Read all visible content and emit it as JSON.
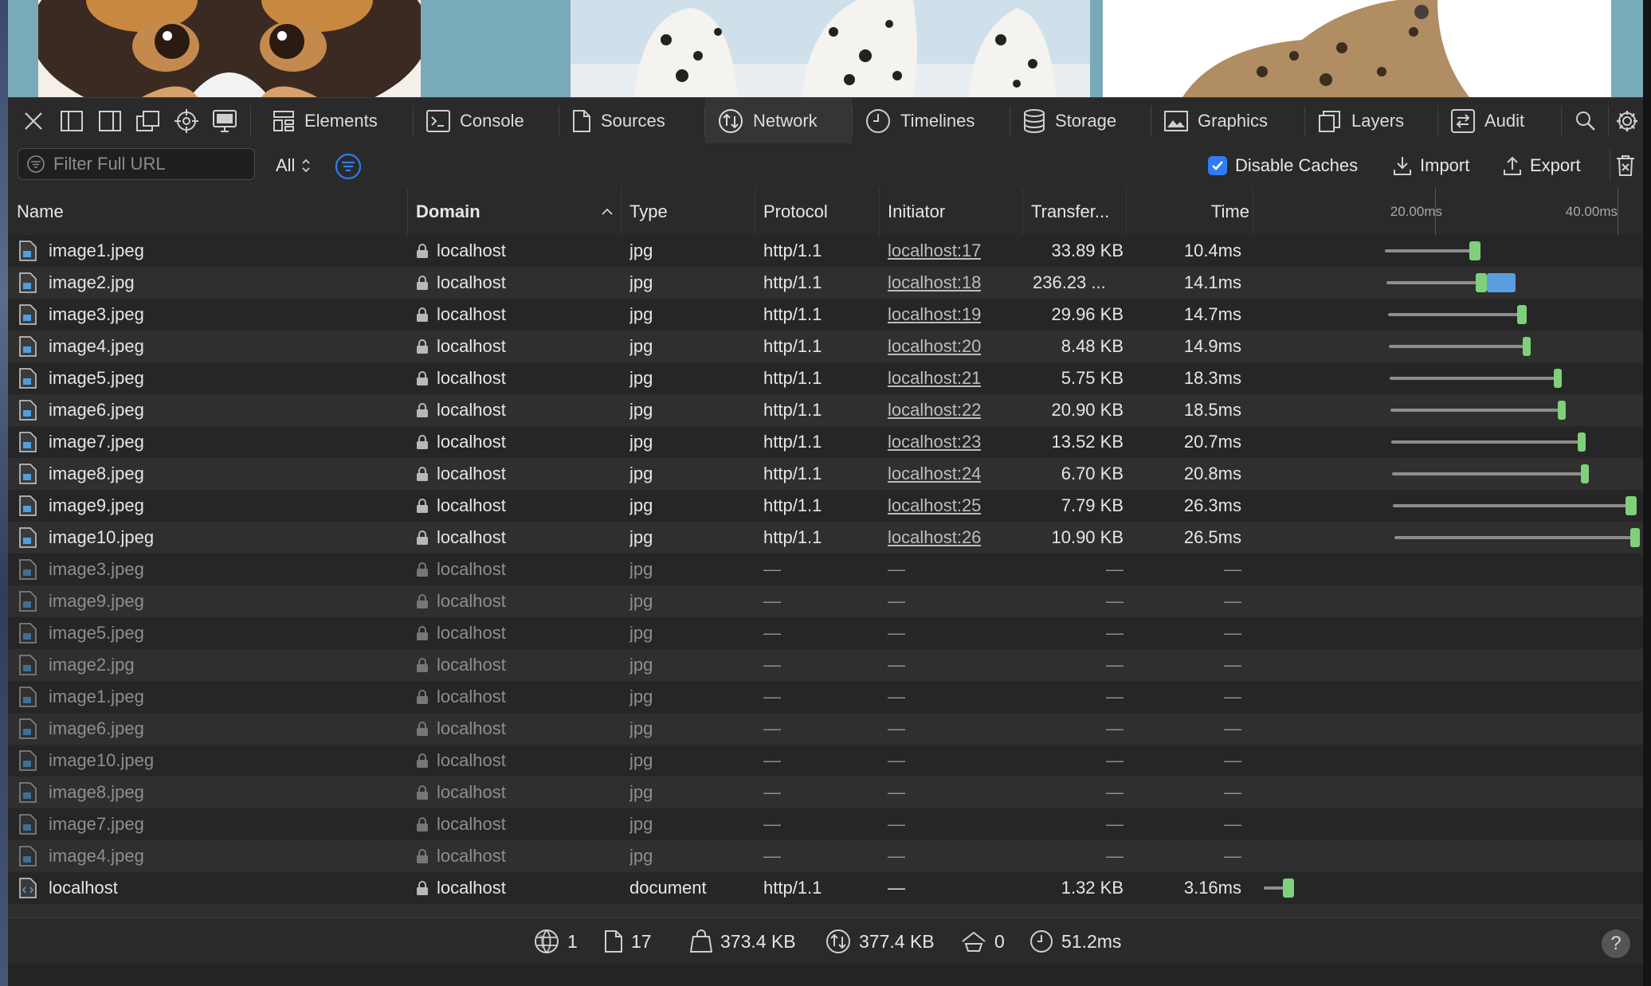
{
  "toolbar": {
    "tabs": [
      {
        "label": "Elements",
        "icon": "elements-icon"
      },
      {
        "label": "Console",
        "icon": "console-icon"
      },
      {
        "label": "Sources",
        "icon": "sources-icon"
      },
      {
        "label": "Network",
        "icon": "network-icon",
        "active": true
      },
      {
        "label": "Timelines",
        "icon": "timelines-icon"
      },
      {
        "label": "Storage",
        "icon": "storage-icon"
      },
      {
        "label": "Graphics",
        "icon": "graphics-icon"
      },
      {
        "label": "Layers",
        "icon": "layers-icon"
      },
      {
        "label": "Audit",
        "icon": "audit-icon"
      }
    ]
  },
  "filterbar": {
    "filter_placeholder": "Filter Full URL",
    "type_filter": "All",
    "disable_caches_label": "Disable Caches",
    "disable_caches_checked": true,
    "import_label": "Import",
    "export_label": "Export"
  },
  "table": {
    "columns": {
      "name": "Name",
      "domain": "Domain",
      "type": "Type",
      "protocol": "Protocol",
      "initiator": "Initiator",
      "transfer": "Transfer...",
      "time": "Time"
    },
    "sort_column": "Domain",
    "waterfall_ticks": [
      "20.00ms",
      "40.00ms"
    ],
    "rows": [
      {
        "name": "image1.jpeg",
        "domain": "localhost",
        "type": "jpg",
        "protocol": "http/1.1",
        "initiator": "localhost:17",
        "transfer": "33.89 KB",
        "time": "10.4ms"
      },
      {
        "name": "image2.jpg",
        "domain": "localhost",
        "type": "jpg",
        "protocol": "http/1.1",
        "initiator": "localhost:18",
        "transfer": "236.23 ...",
        "time": "14.1ms"
      },
      {
        "name": "image3.jpeg",
        "domain": "localhost",
        "type": "jpg",
        "protocol": "http/1.1",
        "initiator": "localhost:19",
        "transfer": "29.96 KB",
        "time": "14.7ms"
      },
      {
        "name": "image4.jpeg",
        "domain": "localhost",
        "type": "jpg",
        "protocol": "http/1.1",
        "initiator": "localhost:20",
        "transfer": "8.48 KB",
        "time": "14.9ms"
      },
      {
        "name": "image5.jpeg",
        "domain": "localhost",
        "type": "jpg",
        "protocol": "http/1.1",
        "initiator": "localhost:21",
        "transfer": "5.75 KB",
        "time": "18.3ms"
      },
      {
        "name": "image6.jpeg",
        "domain": "localhost",
        "type": "jpg",
        "protocol": "http/1.1",
        "initiator": "localhost:22",
        "transfer": "20.90 KB",
        "time": "18.5ms"
      },
      {
        "name": "image7.jpeg",
        "domain": "localhost",
        "type": "jpg",
        "protocol": "http/1.1",
        "initiator": "localhost:23",
        "transfer": "13.52 KB",
        "time": "20.7ms"
      },
      {
        "name": "image8.jpeg",
        "domain": "localhost",
        "type": "jpg",
        "protocol": "http/1.1",
        "initiator": "localhost:24",
        "transfer": "6.70 KB",
        "time": "20.8ms"
      },
      {
        "name": "image9.jpeg",
        "domain": "localhost",
        "type": "jpg",
        "protocol": "http/1.1",
        "initiator": "localhost:25",
        "transfer": "7.79 KB",
        "time": "26.3ms"
      },
      {
        "name": "image10.jpeg",
        "domain": "localhost",
        "type": "jpg",
        "protocol": "http/1.1",
        "initiator": "localhost:26",
        "transfer": "10.90 KB",
        "time": "26.5ms"
      },
      {
        "name": "image3.jpeg",
        "domain": "localhost",
        "type": "jpg",
        "protocol": "—",
        "initiator": "—",
        "transfer": "—",
        "time": "—",
        "dim": true
      },
      {
        "name": "image9.jpeg",
        "domain": "localhost",
        "type": "jpg",
        "protocol": "—",
        "initiator": "—",
        "transfer": "—",
        "time": "—",
        "dim": true
      },
      {
        "name": "image5.jpeg",
        "domain": "localhost",
        "type": "jpg",
        "protocol": "—",
        "initiator": "—",
        "transfer": "—",
        "time": "—",
        "dim": true
      },
      {
        "name": "image2.jpg",
        "domain": "localhost",
        "type": "jpg",
        "protocol": "—",
        "initiator": "—",
        "transfer": "—",
        "time": "—",
        "dim": true
      },
      {
        "name": "image1.jpeg",
        "domain": "localhost",
        "type": "jpg",
        "protocol": "—",
        "initiator": "—",
        "transfer": "—",
        "time": "—",
        "dim": true
      },
      {
        "name": "image6.jpeg",
        "domain": "localhost",
        "type": "jpg",
        "protocol": "—",
        "initiator": "—",
        "transfer": "—",
        "time": "—",
        "dim": true
      },
      {
        "name": "image10.jpeg",
        "domain": "localhost",
        "type": "jpg",
        "protocol": "—",
        "initiator": "—",
        "transfer": "—",
        "time": "—",
        "dim": true
      },
      {
        "name": "image8.jpeg",
        "domain": "localhost",
        "type": "jpg",
        "protocol": "—",
        "initiator": "—",
        "transfer": "—",
        "time": "—",
        "dim": true
      },
      {
        "name": "image7.jpeg",
        "domain": "localhost",
        "type": "jpg",
        "protocol": "—",
        "initiator": "—",
        "transfer": "—",
        "time": "—",
        "dim": true
      },
      {
        "name": "image4.jpeg",
        "domain": "localhost",
        "type": "jpg",
        "protocol": "—",
        "initiator": "—",
        "transfer": "—",
        "time": "—",
        "dim": true
      },
      {
        "name": "localhost",
        "domain": "localhost",
        "type": "document",
        "protocol": "http/1.1",
        "initiator": "—",
        "transfer": "1.32 KB",
        "time": "3.16ms",
        "doc": true
      }
    ]
  },
  "statusbar": {
    "domains": "1",
    "resources": "17",
    "resources_size": "373.4 KB",
    "transferred": "377.4 KB",
    "redirects": "0",
    "elapsed": "51.2ms"
  },
  "colors": {
    "accent": "#2f7cf6",
    "waterfall_green": "#7fd07a",
    "waterfall_blue": "#5b9ee0"
  }
}
